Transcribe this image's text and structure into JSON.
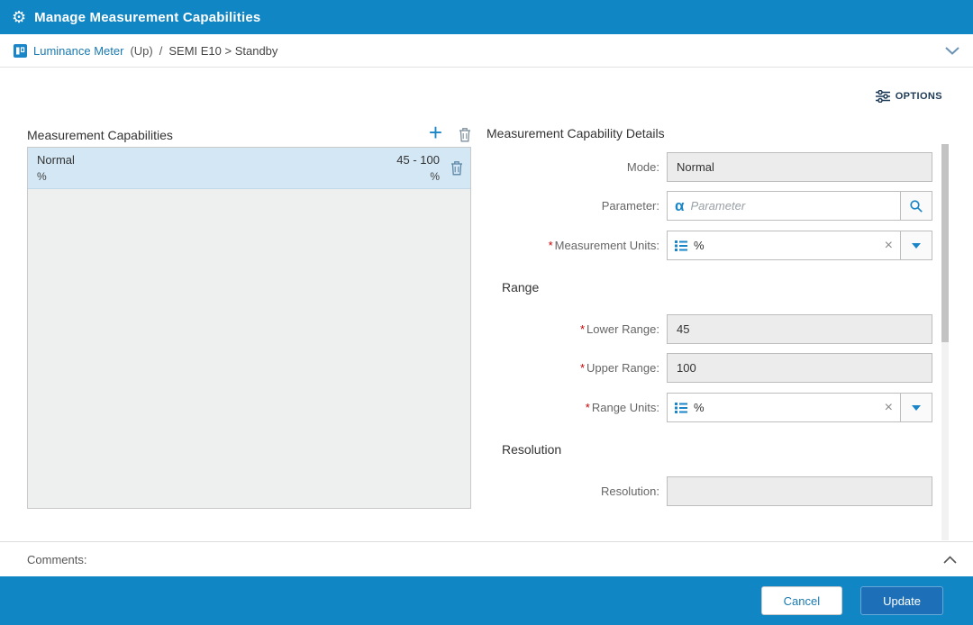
{
  "window": {
    "title": "Manage Measurement Capabilities"
  },
  "breadcrumb": {
    "device": "Luminance Meter",
    "up_label": "(Up)",
    "separator": "/",
    "path": "SEMI E10 > Standby"
  },
  "toolbar": {
    "options_label": "OPTIONS"
  },
  "capabilities_list": {
    "title": "Measurement Capabilities",
    "items": [
      {
        "mode": "Normal",
        "units": "%",
        "range": "45 - 100",
        "range_units": "%"
      }
    ]
  },
  "details": {
    "title": "Measurement Capability Details",
    "required_marker": "*",
    "mode": {
      "label": "Mode:",
      "value": "Normal"
    },
    "parameter": {
      "label": "Parameter:",
      "placeholder": "Parameter",
      "value": ""
    },
    "measurement_units": {
      "label": "Measurement Units:",
      "value": "%"
    },
    "range_section": {
      "title": "Range"
    },
    "lower_range": {
      "label": "Lower Range:",
      "value": "45"
    },
    "upper_range": {
      "label": "Upper Range:",
      "value": "100"
    },
    "range_units": {
      "label": "Range Units:",
      "value": "%"
    },
    "resolution_section": {
      "title": "Resolution"
    },
    "resolution": {
      "label": "Resolution:",
      "value": ""
    }
  },
  "comments": {
    "label": "Comments:"
  },
  "footer": {
    "cancel_label": "Cancel",
    "update_label": "Update"
  },
  "icons": {
    "gear": "⚙",
    "plus": "+",
    "clear": "×",
    "alpha": "α"
  },
  "colors": {
    "header_bg": "#1186c5",
    "accent": "#1a86c8",
    "link": "#1a7ab0",
    "required": "#c40000",
    "selected_row_bg": "#d3e7f5",
    "update_button_bg": "#1d70b8"
  }
}
